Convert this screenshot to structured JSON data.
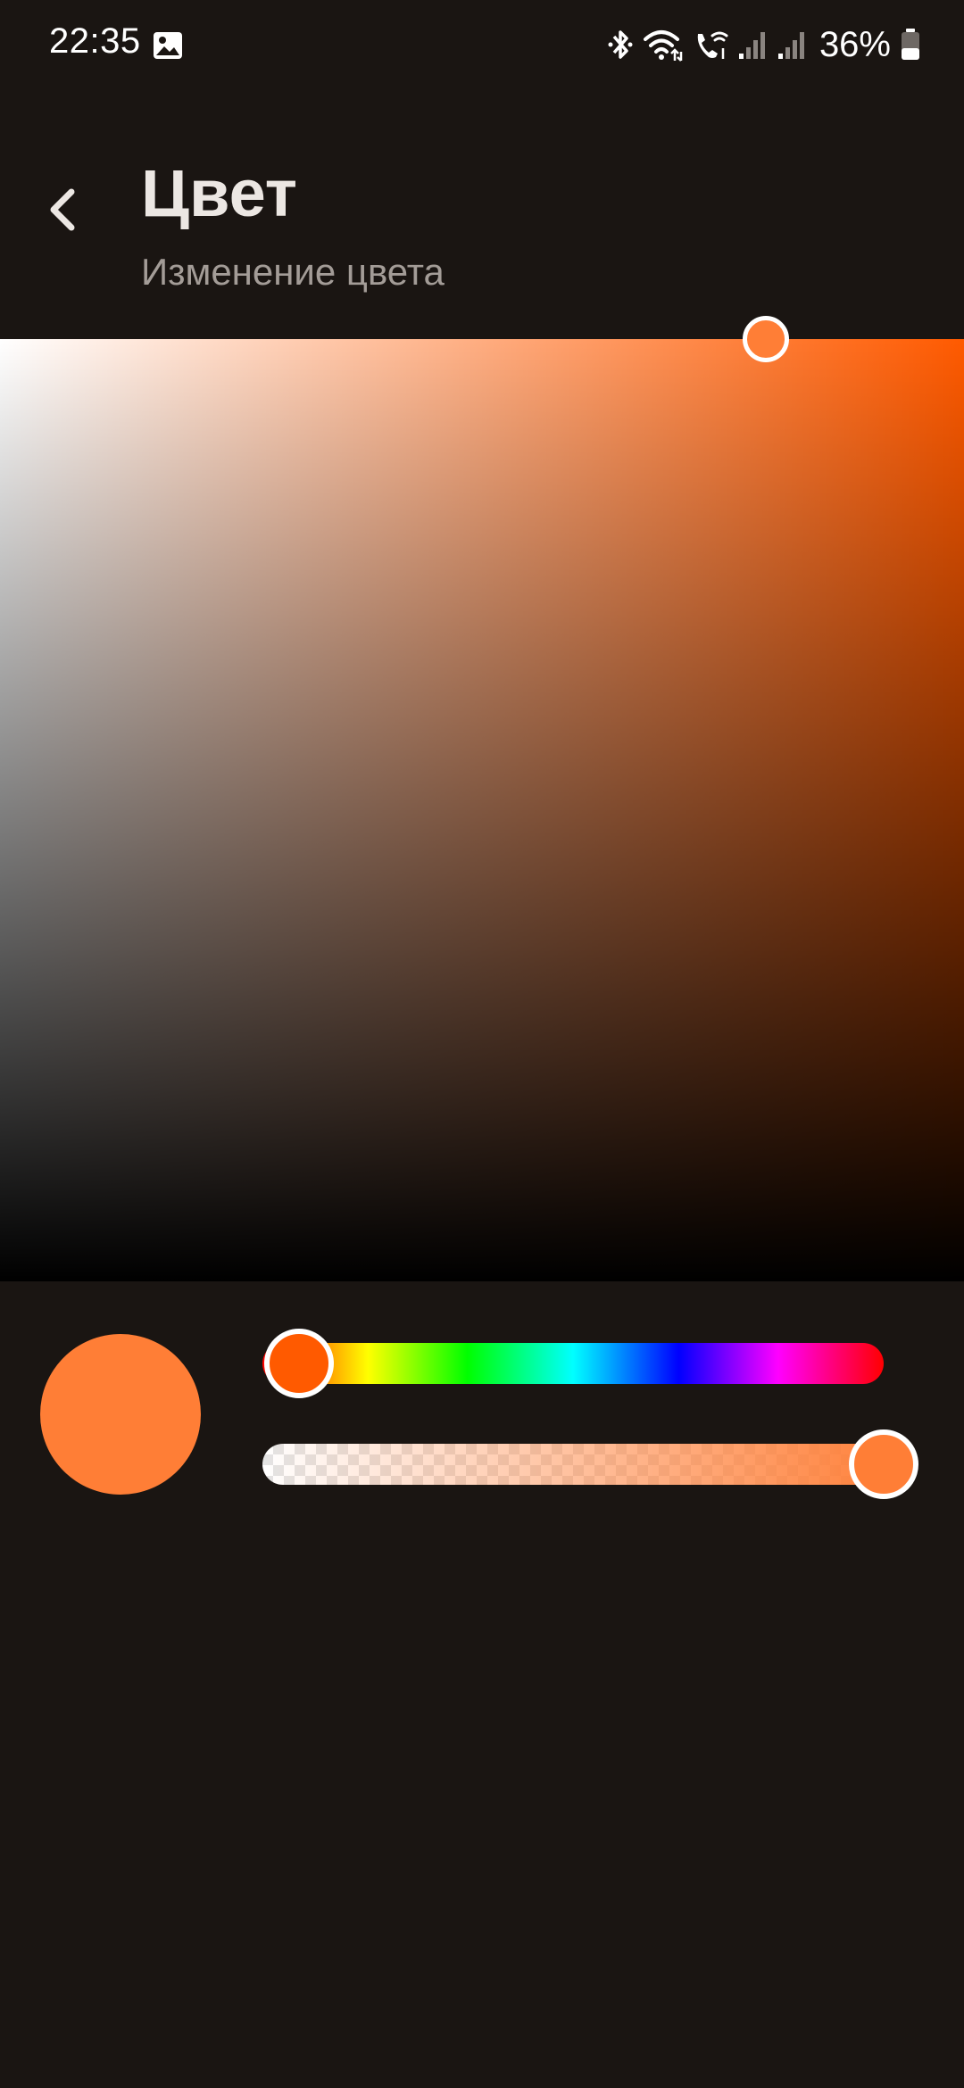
{
  "status_bar": {
    "time": "22:35",
    "battery_percent": "36%",
    "icons": [
      "gallery-icon",
      "bluetooth-icon",
      "wifi-icon",
      "wifi-calling-icon",
      "signal-icon",
      "signal-icon",
      "battery-icon"
    ]
  },
  "header": {
    "back_icon": "chevron-left-icon",
    "title": "Цвет",
    "subtitle": "Изменение цвета"
  },
  "color_picker": {
    "hue_color": "#ff5a00",
    "selected_color": "#ff7e36",
    "saturation": 0.79,
    "value": 1.0,
    "hue_position": 0.05,
    "alpha": 1.0
  }
}
